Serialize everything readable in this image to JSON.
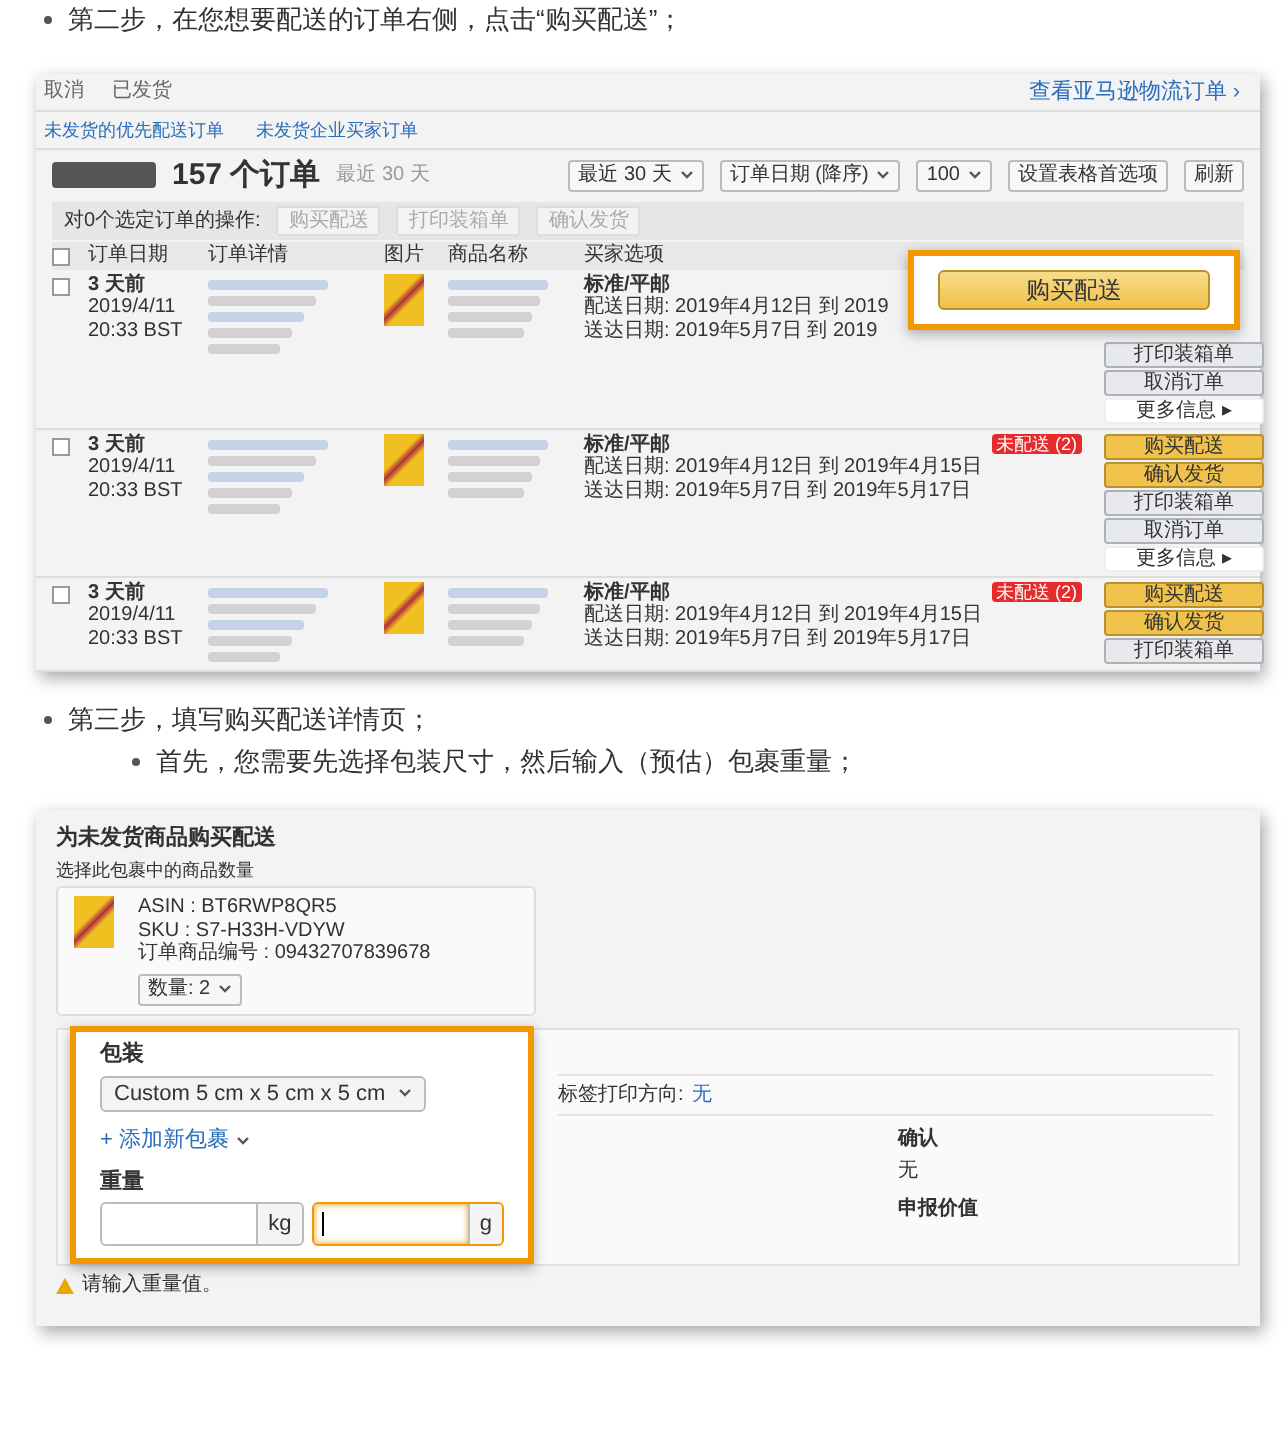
{
  "step2": "第二步，在您想要配送的订单右侧，点击“购买配送”；",
  "orders_screen": {
    "tabs": [
      {
        "label": "取消",
        "selected": false
      },
      {
        "label": "已发货",
        "selected": false
      }
    ],
    "fba_link": "查看亚马逊物流订单 ›",
    "filters": [
      "未发货的优先配送订单",
      "未发货企业买家订单"
    ],
    "count": "157 个订单",
    "period": "最近 30 天",
    "dropdowns": [
      "最近 30 天",
      "订单日期 (降序)",
      "100"
    ],
    "buttons": [
      "设置表格首选项",
      "刷新"
    ],
    "bulk_label": "对0个选定订单的操作:",
    "bulk_actions": [
      {
        "label": "购买配送",
        "disabled": true
      },
      {
        "label": "打印装箱单",
        "disabled": true
      },
      {
        "label": "确认发货",
        "disabled": true
      }
    ],
    "select_all_checked": false,
    "columns": [
      "订单日期",
      "订单详情",
      "图片",
      "商品名称",
      "买家选项"
    ],
    "rows": [
      {
        "checked": false,
        "age": "3 天前",
        "date": "2019/4/11",
        "time": "20:33 BST",
        "service": "标准/平邮",
        "ship_by": "配送日期: 2019年4月12日 到 2019",
        "deliver_by": "送达日期: 2019年5月7日 到 2019",
        "actions": [
          {
            "kind": "secondary",
            "label": "打印装箱单"
          },
          {
            "kind": "secondary",
            "label": "取消订单"
          },
          {
            "kind": "link",
            "label": "更多信息 ▸"
          }
        ]
      },
      {
        "checked": false,
        "age": "3 天前",
        "date": "2019/4/11",
        "time": "20:33 BST",
        "service": "标准/平邮",
        "ship_by": "配送日期: 2019年4月12日 到 2019年4月15日",
        "deliver_by": "送达日期: 2019年5月7日 到 2019年5月17日",
        "badge": "未配送 (2)",
        "actions": [
          {
            "kind": "primary",
            "label": "购买配送"
          },
          {
            "kind": "primary",
            "label": "确认发货"
          },
          {
            "kind": "secondary",
            "label": "打印装箱单"
          },
          {
            "kind": "secondary",
            "label": "取消订单"
          },
          {
            "kind": "link",
            "label": "更多信息 ▸"
          }
        ]
      },
      {
        "checked": false,
        "age": "3 天前",
        "date": "2019/4/11",
        "time": "20:33 BST",
        "service": "标准/平邮",
        "ship_by": "配送日期: 2019年4月12日 到 2019年4月15日",
        "deliver_by": "送达日期: 2019年5月7日 到 2019年5月17日",
        "badge": "未配送 (2)",
        "actions": [
          {
            "kind": "primary",
            "label": "购买配送"
          },
          {
            "kind": "primary",
            "label": "确认发货"
          },
          {
            "kind": "secondary",
            "label": "打印装箱单"
          }
        ]
      }
    ],
    "callout": "购买配送"
  },
  "step3": "第三步，填写购买配送详情页；",
  "step3_sub": "首先，您需要先选择包装尺寸，然后输入（预估）包裹重量；",
  "purchase_screen": {
    "title": "为未发货商品购买配送",
    "subtitle": "选择此包裹中的商品数量",
    "item": {
      "asin": "ASIN : BT6RWP8QR5",
      "sku": "SKU : S7-H33H-VDYW",
      "order_item": "订单商品编号 : 09432707839678",
      "quantity": "数量: 2"
    },
    "package_label": "包装",
    "package_value": "Custom 5 cm x 5 cm x 5 cm",
    "add_package": "+ 添加新包裹",
    "weight_label": "重量",
    "weight_fields": [
      {
        "unit": "kg",
        "focused": false
      },
      {
        "unit": "g",
        "focused": true
      }
    ],
    "warning": "请输入重量值。",
    "orientation_label": "标签打印方向:",
    "orientation_value": "无",
    "confirm_label": "确认",
    "confirm_value": "无",
    "declared_label": "申报价值"
  }
}
